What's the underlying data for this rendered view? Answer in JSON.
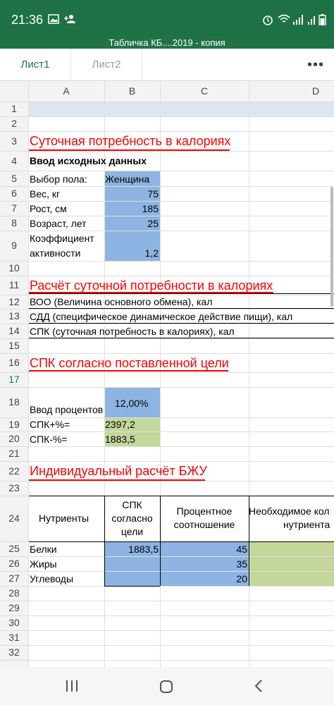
{
  "status_bar": {
    "time": "21:36"
  },
  "window_title": "Табличка КБ....2019 - копия",
  "tabs": [
    {
      "label": "Лист1",
      "active": true
    },
    {
      "label": "Лист2",
      "active": false
    }
  ],
  "columns": [
    "A",
    "B",
    "C",
    "D"
  ],
  "rows": [
    "1",
    "2",
    "3",
    "4",
    "5",
    "6",
    "7",
    "8",
    "9",
    "10",
    "11",
    "12",
    "13",
    "14",
    "15",
    "16",
    "17",
    "18",
    "19",
    "20",
    "21",
    "22",
    "23",
    "24",
    "25",
    "26",
    "27",
    "28",
    "29",
    "30",
    "31",
    "32"
  ],
  "selected_row": "17",
  "sections": {
    "calories_title": "Суточная потребность в калориях",
    "input_title": "Ввод исходных данных",
    "calc_title": "Расчёт суточной потребности в калориях",
    "goal_title": "СПК согласно поставленной цели",
    "bju_title": "Индивидуальный расчёт БЖУ"
  },
  "inputs": {
    "gender_label": "Выбор пола:",
    "gender_value": "Женщина",
    "weight_label": "Вес, кг",
    "weight_value": "75",
    "height_label": "Рост, см",
    "height_value": "185",
    "age_label": "Возраст, лет",
    "age_value": "25",
    "activity_label_1": "Коэффициент",
    "activity_label_2": "активности",
    "activity_value": "1,2"
  },
  "calc_rows": {
    "voo": "ВОО (Величина основного обмена), кал",
    "sdd": "СДД (специфическое динамическое действие пищи), кал",
    "spk": "СПК (суточная потребность в калориях), кал"
  },
  "goal": {
    "percent_label": "Ввод процентов",
    "percent_value": "12,00%",
    "plus_label": "СПК+%=",
    "plus_value": "2397,2",
    "minus_label": "СПК-%=",
    "minus_value": "1883,5"
  },
  "bju": {
    "header_nutrients": "Нутриенты",
    "header_spk_1": "СПК",
    "header_spk_2": "согласно",
    "header_spk_3": "цели",
    "header_pct_1": "Процентное",
    "header_pct_2": "соотношение",
    "header_need_1": "Необходимое кол",
    "header_need_2": "нутриента",
    "spk_value": "1883,5",
    "rows": [
      {
        "name": "Белки",
        "pct": "45"
      },
      {
        "name": "Жиры",
        "pct": "35"
      },
      {
        "name": "Углеводы",
        "pct": "20"
      }
    ]
  },
  "colors": {
    "header_green": "#217346",
    "input_blue": "#8db4e2",
    "result_green": "#c4d79b",
    "title_red": "#ff0000"
  }
}
